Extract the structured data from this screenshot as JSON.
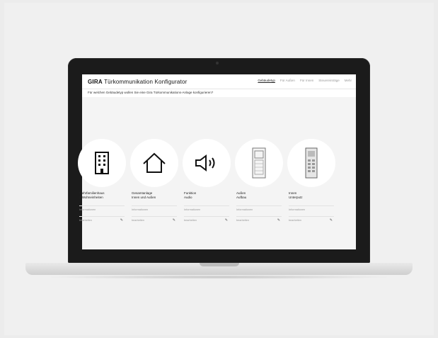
{
  "app": {
    "brand_bold": "GIRA",
    "brand_rest": "Türkommunikation Konfigurator"
  },
  "nav": {
    "items": [
      {
        "label": "Gebäudetyp",
        "active": true
      },
      {
        "label": "Für Außen",
        "active": false
      },
      {
        "label": "Für Innen",
        "active": false
      },
      {
        "label": "Steuereinträge",
        "active": false
      },
      {
        "label": "Mehr",
        "active": false
      }
    ]
  },
  "question": "Für welchen Gebäudetyp wollen Sie eine Gira Türkommunikations-Anlage konfigurieren?",
  "cards": [
    {
      "icon": "apartment-building-icon",
      "title_line1": "Mehrfamilienhaus",
      "title_line2": "3 Wohneinheiten",
      "info": "Informationen",
      "edit": "bearbeiten"
    },
    {
      "icon": "house-icon",
      "title_line1": "Gesamtanlage",
      "title_line2": "Innen und Außen",
      "info": "Informationen",
      "edit": "bearbeiten"
    },
    {
      "icon": "speaker-icon",
      "title_line1": "Funktion",
      "title_line2": "Audio",
      "info": "Informationen",
      "edit": "bearbeiten"
    },
    {
      "icon": "door-station-icon",
      "title_line1": "Außen",
      "title_line2": "Aufbau",
      "info": "Informationen",
      "edit": "bearbeiten"
    },
    {
      "icon": "intercom-panel-icon",
      "title_line1": "Innen",
      "title_line2": "Unterputz",
      "info": "Informationen",
      "edit": "bearbeiten"
    }
  ]
}
